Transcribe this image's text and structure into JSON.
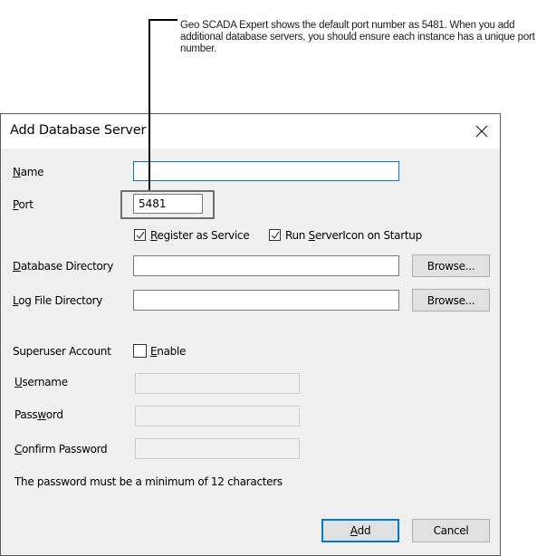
{
  "callout": {
    "text": "Geo SCADA Expert shows the default port number as 5481. When you add additional database servers, you should ensure each instance has a unique port number."
  },
  "dialog": {
    "title": "Add Database Server",
    "close_icon": "close-icon",
    "fields": {
      "name": {
        "label_pre": "",
        "label_ul": "N",
        "label_post": "ame",
        "value": ""
      },
      "port": {
        "label_pre": "",
        "label_ul": "P",
        "label_post": "ort",
        "value": "5481"
      },
      "database_directory": {
        "label_pre": "",
        "label_ul": "D",
        "label_post": "atabase Directory",
        "value": ""
      },
      "log_file_directory": {
        "label_pre": "",
        "label_ul": "L",
        "label_post": "og File Directory",
        "value": ""
      },
      "username": {
        "label_pre": "",
        "label_ul": "U",
        "label_post": "sername",
        "value": ""
      },
      "password": {
        "label_pre": "Pass",
        "label_ul": "w",
        "label_post": "ord",
        "value": ""
      },
      "confirm_password": {
        "label_pre": "",
        "label_ul": "C",
        "label_post": "onfirm Password",
        "value": ""
      }
    },
    "checkboxes": {
      "register_service": {
        "label_pre": "",
        "label_ul": "R",
        "label_post": "egister as Service",
        "checked": true
      },
      "run_servericon": {
        "label_pre": "Run ",
        "label_ul": "S",
        "label_post": "erverIcon on Startup",
        "checked": true
      },
      "enable": {
        "label_pre": "",
        "label_ul": "E",
        "label_post": "nable",
        "checked": false
      }
    },
    "superuser_label": "Superuser Account",
    "browse_label": "Browse...",
    "password_note": "The password must be a minimum of 12 characters",
    "buttons": {
      "add": {
        "label_pre": "",
        "label_ul": "A",
        "label_post": "dd"
      },
      "cancel": "Cancel"
    }
  }
}
